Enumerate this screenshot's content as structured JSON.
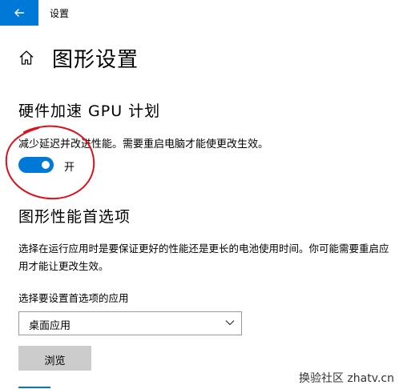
{
  "window": {
    "title": "设置"
  },
  "page": {
    "title": "图形设置"
  },
  "gpu_section": {
    "title": "硬件加速 GPU 计划",
    "description": "减少延迟并改进性能。需要重启电脑才能使更改生效。",
    "toggle_state": "开"
  },
  "perf_section": {
    "title": "图形性能首选项",
    "description": "选择在运行应用时是要保证更好的性能还是更长的电池使用时间。你可能需要重启应用才能让更改生效。",
    "select_label": "选择要设置首选项的应用",
    "select_value": "桌面应用",
    "browse_label": "浏览"
  },
  "watermark": "换验社区 zhatv.cn",
  "colors": {
    "accent": "#0078d7",
    "annotation": "#e0101a"
  }
}
